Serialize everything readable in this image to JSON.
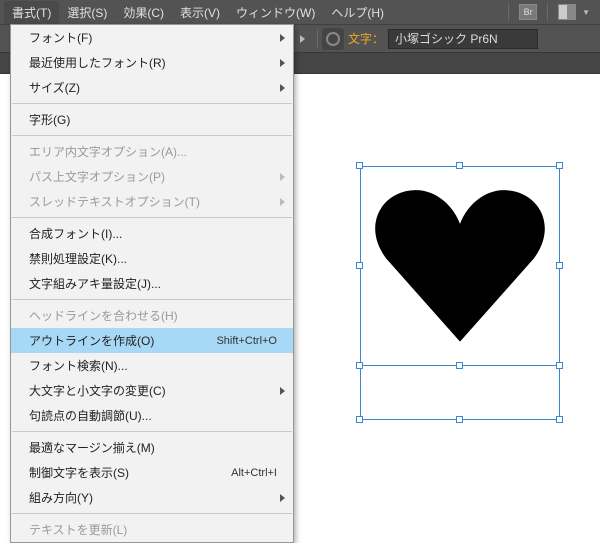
{
  "menubar": {
    "items": [
      {
        "label": "書式(T)",
        "active": true
      },
      {
        "label": "選択(S)"
      },
      {
        "label": "効果(C)"
      },
      {
        "label": "表示(V)"
      },
      {
        "label": "ウィンドウ(W)"
      },
      {
        "label": "ヘルプ(H)"
      }
    ],
    "br_label": "Br"
  },
  "toolbar": {
    "font_label": "文字：",
    "font_value": "小塚ゴシック Pr6N"
  },
  "dropdown": {
    "groups": [
      [
        {
          "label": "フォント(F)",
          "submenu": true
        },
        {
          "label": "最近使用したフォント(R)",
          "submenu": true
        },
        {
          "label": "サイズ(Z)",
          "submenu": true
        }
      ],
      [
        {
          "label": "字形(G)"
        }
      ],
      [
        {
          "label": "エリア内文字オプション(A)...",
          "disabled": true
        },
        {
          "label": "パス上文字オプション(P)",
          "disabled": true,
          "submenu": true
        },
        {
          "label": "スレッドテキストオプション(T)",
          "disabled": true,
          "submenu": true
        }
      ],
      [
        {
          "label": "合成フォント(I)..."
        },
        {
          "label": "禁則処理設定(K)..."
        },
        {
          "label": "文字組みアキ量設定(J)..."
        }
      ],
      [
        {
          "label": "ヘッドラインを合わせる(H)",
          "disabled": true
        },
        {
          "label": "アウトラインを作成(O)",
          "shortcut": "Shift+Ctrl+O",
          "highlighted": true
        },
        {
          "label": "フォント検索(N)..."
        },
        {
          "label": "大文字と小文字の変更(C)",
          "submenu": true
        },
        {
          "label": "句読点の自動調節(U)..."
        }
      ],
      [
        {
          "label": "最適なマージン揃え(M)"
        },
        {
          "label": "制御文字を表示(S)",
          "shortcut": "Alt+Ctrl+I"
        },
        {
          "label": "組み方向(Y)",
          "submenu": true
        }
      ],
      [
        {
          "label": "テキストを更新(L)",
          "disabled": true
        }
      ]
    ]
  },
  "canvas": {
    "heart_color": "#000000",
    "selection_color": "#3a87d6"
  }
}
